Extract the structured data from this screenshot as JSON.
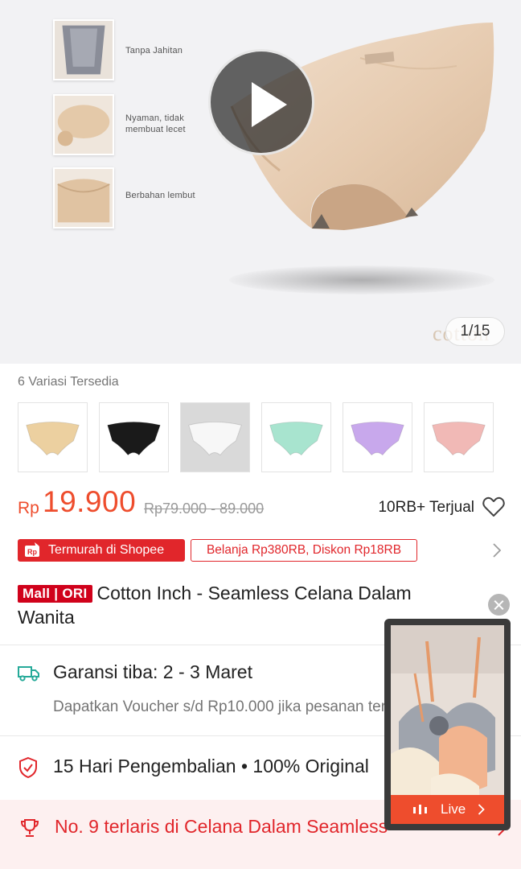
{
  "hero": {
    "features": [
      "Tanpa Jahitan",
      "Nyaman, tidak membuat lecet",
      "Berbahan lembut"
    ],
    "watermark": "cotton",
    "image_counter": "1/15",
    "icons": {
      "play": "play-icon"
    }
  },
  "variants": {
    "label": "6 Variasi Tersedia",
    "swatches": [
      {
        "color": "#ecd0a0",
        "selected": false
      },
      {
        "color": "#1a1a1a",
        "selected": false
      },
      {
        "color": "#f7f7f7",
        "selected": true
      },
      {
        "color": "#a8e4cf",
        "selected": false
      },
      {
        "color": "#c8a8ec",
        "selected": false
      },
      {
        "color": "#f1b9b6",
        "selected": false
      }
    ]
  },
  "price": {
    "currency": "Rp",
    "value": "19.900",
    "original_range": "Rp79.000 - 89.000",
    "sold": "10RB+ Terjual"
  },
  "badges": {
    "shopee_label": "Termurah di Shopee",
    "voucher_label": "Belanja Rp380RB, Diskon Rp18RB"
  },
  "product": {
    "mall_badge": "Mall | ORI",
    "title": "Cotton Inch - Seamless Celana Dalam Wanita"
  },
  "shipping": {
    "title": "Garansi tiba: 2 - 3 Maret",
    "subtitle": "Dapatkan Voucher s/d Rp10.000 jika pesanan terlambat."
  },
  "returns": {
    "text": "15 Hari Pengembalian  •  100% Original"
  },
  "bestseller": {
    "text": "No. 9 terlaris di Celana Dalam Seamless"
  },
  "live": {
    "label": "Live"
  },
  "colors": {
    "accent": "#ee4d2d",
    "badge_red": "#e1262b",
    "mall_red": "#d0011b"
  }
}
